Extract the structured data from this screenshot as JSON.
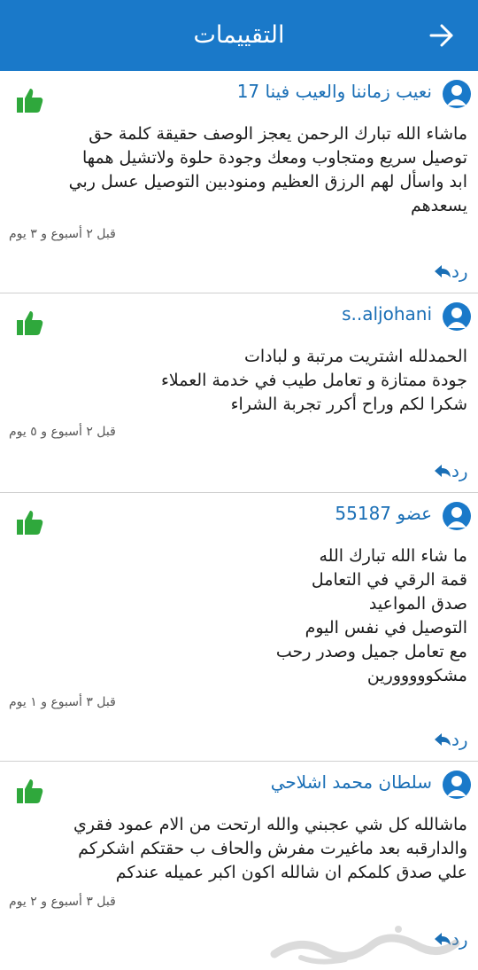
{
  "header": {
    "title": "التقييمات",
    "bg": "#1a79c9"
  },
  "reviews": [
    {
      "author": "نعيب زماننا والعيب فينا  17",
      "text": "ماشاء الله تبارك الرحمن يعجز الوصف حقيقة كلمة حق\nتوصيل سريع ومتجاوب ومعك وجودة حلوة ولاتشيل همها\nابد واسأل لهم الرزق العظيم ومنودبين التوصيل عسل ربي\nيسعدهم",
      "time": "قبل ٢ أسبوع و ٣ يوم",
      "reply": "رد"
    },
    {
      "author": "s..aljohani",
      "text": "الحمدلله اشتريت مرتبة و لبادات\nجودة ممتازة و تعامل طيب في خدمة العملاء\nشكرا  لكم وراح أكرر تجربة الشراء",
      "time": "قبل ٢ أسبوع و ٥ يوم",
      "reply": "رد"
    },
    {
      "author": "عضو 55187",
      "text": "ما شاء الله تبارك الله\nقمة الرقي في التعامل\nصدق المواعيد\nالتوصيل في نفس اليوم\nمع تعامل جميل وصدر رحب\nمشكووووورين",
      "time": "قبل ٣ أسبوع و ١ يوم",
      "reply": "رد"
    },
    {
      "author": "سلطان محمد اشلاحي",
      "text": "ماشالله كل شي عجبني والله ارتحت من الام عمود فقري\nوالدارقبه بعد ماغيرت مفرش والحاف ب  حقتكم اشكركم\nعلي صدق كلمكم  ان شالله اكون اكبر عميله عندكم",
      "time": "قبل ٣ أسبوع و ٢ يوم",
      "reply": "رد"
    }
  ],
  "icons": {
    "back": "arrow-right-icon",
    "like": "thumbs-up-icon",
    "avatar": "user-avatar-icon",
    "reply": "reply-icon"
  },
  "colors": {
    "like_green": "#2fa83c",
    "link_blue": "#1a6fb6"
  },
  "watermark": "حراج"
}
